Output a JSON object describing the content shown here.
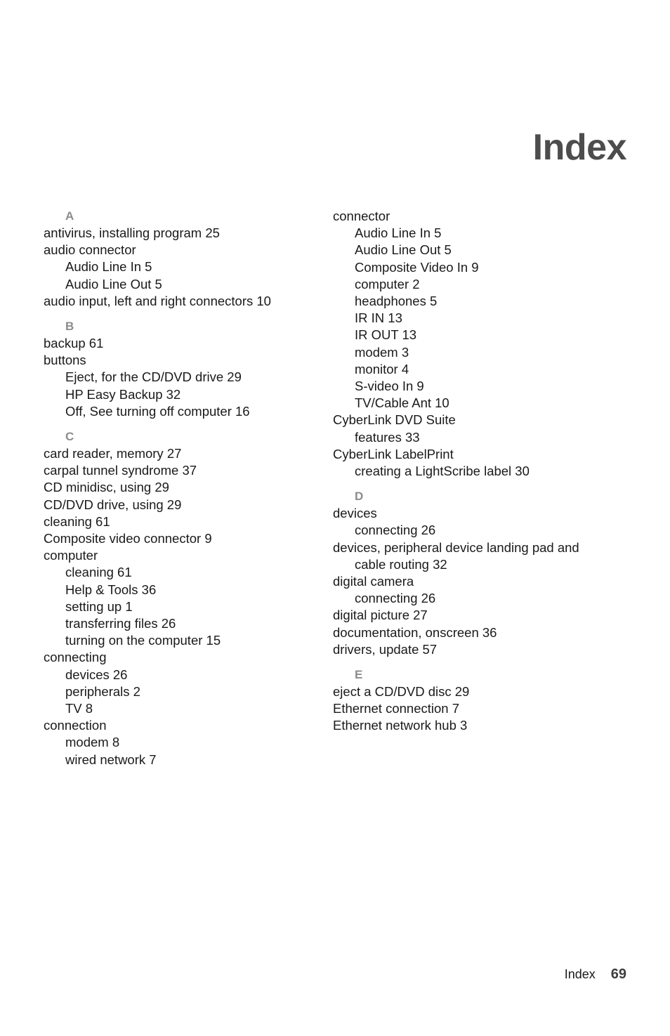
{
  "title": "Index",
  "footer": {
    "label": "Index",
    "page_number": "69"
  },
  "colors": {
    "title": "#4d4d4d",
    "section_letter": "#8c8c8c",
    "body_text": "#1a1a1a",
    "page_background": "#ffffff"
  },
  "columns": [
    {
      "id": "left",
      "sections": [
        {
          "letter": "A",
          "entries": [
            {
              "level": 1,
              "text": "antivirus, installing program 25"
            },
            {
              "level": 1,
              "text": "audio connector"
            },
            {
              "level": 2,
              "text": "Audio Line In 5"
            },
            {
              "level": 2,
              "text": "Audio Line Out 5"
            },
            {
              "level": 1,
              "text": "audio input, left and right connectors 10"
            }
          ]
        },
        {
          "letter": "B",
          "entries": [
            {
              "level": 1,
              "text": "backup 61"
            },
            {
              "level": 1,
              "text": "buttons"
            },
            {
              "level": 2,
              "text": "Eject, for the CD/DVD drive 29"
            },
            {
              "level": 2,
              "text": "HP Easy Backup 32"
            },
            {
              "level": 2,
              "text": "Off, See turning off computer 16"
            }
          ]
        },
        {
          "letter": "C",
          "entries": [
            {
              "level": 1,
              "text": "card reader, memory 27"
            },
            {
              "level": 1,
              "text": "carpal tunnel syndrome 37"
            },
            {
              "level": 1,
              "text": "CD minidisc, using 29"
            },
            {
              "level": 1,
              "text": "CD/DVD drive, using 29"
            },
            {
              "level": 1,
              "text": "cleaning 61"
            },
            {
              "level": 1,
              "text": "Composite video connector 9"
            },
            {
              "level": 1,
              "text": "computer"
            },
            {
              "level": 2,
              "text": "cleaning 61"
            },
            {
              "level": 2,
              "text": "Help & Tools 36"
            },
            {
              "level": 2,
              "text": "setting up 1"
            },
            {
              "level": 2,
              "text": "transferring files 26"
            },
            {
              "level": 2,
              "text": "turning on the computer 15"
            },
            {
              "level": 1,
              "text": "connecting"
            },
            {
              "level": 2,
              "text": "devices 26"
            },
            {
              "level": 2,
              "text": "peripherals 2"
            },
            {
              "level": 2,
              "text": "TV 8"
            },
            {
              "level": 1,
              "text": "connection"
            },
            {
              "level": 2,
              "text": "modem 8"
            },
            {
              "level": 2,
              "text": "wired network 7"
            }
          ]
        }
      ]
    },
    {
      "id": "right",
      "sections": [
        {
          "letter": "",
          "entries": [
            {
              "level": 1,
              "text": "connector"
            },
            {
              "level": 2,
              "text": "Audio Line In 5"
            },
            {
              "level": 2,
              "text": "Audio Line Out 5"
            },
            {
              "level": 2,
              "text": "Composite Video In 9"
            },
            {
              "level": 2,
              "text": "computer 2"
            },
            {
              "level": 2,
              "text": "headphones 5"
            },
            {
              "level": 2,
              "text": "IR IN 13"
            },
            {
              "level": 2,
              "text": "IR OUT 13"
            },
            {
              "level": 2,
              "text": "modem 3"
            },
            {
              "level": 2,
              "text": "monitor 4"
            },
            {
              "level": 2,
              "text": "S-video In 9"
            },
            {
              "level": 2,
              "text": "TV/Cable Ant 10"
            },
            {
              "level": 1,
              "text": "CyberLink DVD Suite"
            },
            {
              "level": 2,
              "text": "features 33"
            },
            {
              "level": 1,
              "text": "CyberLink LabelPrint"
            },
            {
              "level": 2,
              "text": "creating a LightScribe label 30"
            }
          ]
        },
        {
          "letter": "D",
          "entries": [
            {
              "level": 1,
              "text": "devices"
            },
            {
              "level": 2,
              "text": "connecting 26"
            },
            {
              "level": 1,
              "text": "devices, peripheral device landing pad and"
            },
            {
              "level": 2,
              "text": "cable routing 32"
            },
            {
              "level": 1,
              "text": "digital camera"
            },
            {
              "level": 2,
              "text": "connecting 26"
            },
            {
              "level": 1,
              "text": "digital picture 27"
            },
            {
              "level": 1,
              "text": "documentation, onscreen 36"
            },
            {
              "level": 1,
              "text": "drivers, update 57"
            }
          ]
        },
        {
          "letter": "E",
          "entries": [
            {
              "level": 1,
              "text": "eject a CD/DVD disc 29"
            },
            {
              "level": 1,
              "text": "Ethernet connection 7"
            },
            {
              "level": 1,
              "text": "Ethernet network hub 3"
            }
          ]
        }
      ]
    }
  ]
}
